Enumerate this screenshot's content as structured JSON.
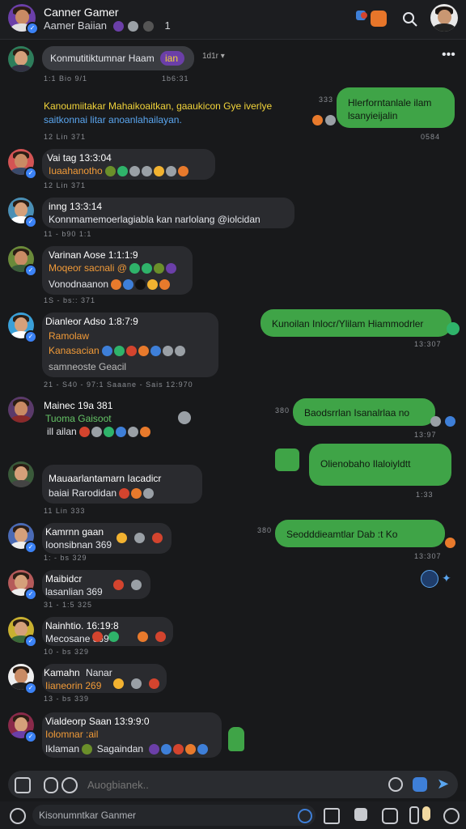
{
  "header": {
    "title": "Canner Gamer",
    "subtitle": "Aamer Baiian",
    "count": "1",
    "icons": [
      "avatar",
      "emoji-icon",
      "emoji-icon",
      "emoji-icon",
      "notification-icon",
      "search-icon",
      "profile-avatar"
    ]
  },
  "messages": [
    {
      "name": "",
      "text": "Konmutitiktumnar Haam",
      "tag": "ian",
      "meta": "1:1 Bio 9/1",
      "meta2": "1b6:31",
      "extra": "1d1r ▾"
    },
    {
      "line1": "Kanoumiitakar Mahaikoaitkan, gaaukicon Gye iverlye",
      "line2": "saitkonnai litar anoanlahailayan.",
      "meta": "12 Lin 371"
    },
    {
      "name": "Vai tag 13:3:04",
      "text": "Iuaahanotho",
      "meta": "12 Lin 371"
    },
    {
      "name": "inng 13:3:14",
      "text": "Konnmamemoerlagiabla kan narlolang @iolcidan",
      "meta": "11 - b90 1:1"
    },
    {
      "name": "Varinan Aose 1:1:1:9",
      "text": "Moqeor sacnali @",
      "text2": "Vonodnaanon",
      "meta": "1S - bs:: 371"
    },
    {
      "name": "Dianleor Adso 1:8:7:9",
      "text": "Ramolaw",
      "text2": "Kanasacian",
      "text3": "samneoste Geacil",
      "meta": "21 - S40 - 97:1 Saaane - Sais 12:970"
    },
    {
      "name": "Mainec 19a 381",
      "text": "Tuoma  Gaisoot",
      "text2": "ill ailan",
      "meta": "-"
    },
    {
      "name": "Mauaarlantamarn Iacadicr",
      "text": "baiai  Rarodidan",
      "meta": "11 Lin 333"
    },
    {
      "name": "Kamrnn gaan",
      "text": "Ioonsibnan 369",
      "meta": "1: - bs 329"
    },
    {
      "name": "Maibidcr",
      "text": "lasanlian 369",
      "meta": "31 - 1:5 325"
    },
    {
      "name": "Nainhtio. 16:19:8",
      "text": "Mecosane 369",
      "meta": "10 - bs 329"
    },
    {
      "name": "Kamahn",
      "text": "Nanar",
      "text2": "Iianeorin 269",
      "meta": "13 - bs 339"
    },
    {
      "name": "Vialdeorp Saan 13:9:9:0",
      "text": "Iolomnar :ail",
      "text2": "Iklaman",
      "text3": "Sagaindan",
      "meta": ""
    }
  ],
  "outgoing": [
    {
      "text": "Hlerforntanlale ilam",
      "text2": "lsanyieijalin",
      "time": "333",
      "meta": "0584"
    },
    {
      "text": "Kunoilan Inlocr/Ylilam  Hiammodrler",
      "meta": "13:307"
    },
    {
      "text": "Baodsrrlan Isanalrlaa no",
      "time": "380",
      "meta": "13:97"
    },
    {
      "text": "Olienobaho Ilaloiyldtt",
      "meta": "1:33"
    },
    {
      "text": "Seodddieamtlar Dab :t Ko",
      "time": "380",
      "meta": "13:307"
    }
  ],
  "input": {
    "placeholder": "Auogbianek.."
  },
  "bottom": {
    "text": "Kisonumntkar Ganmer"
  }
}
